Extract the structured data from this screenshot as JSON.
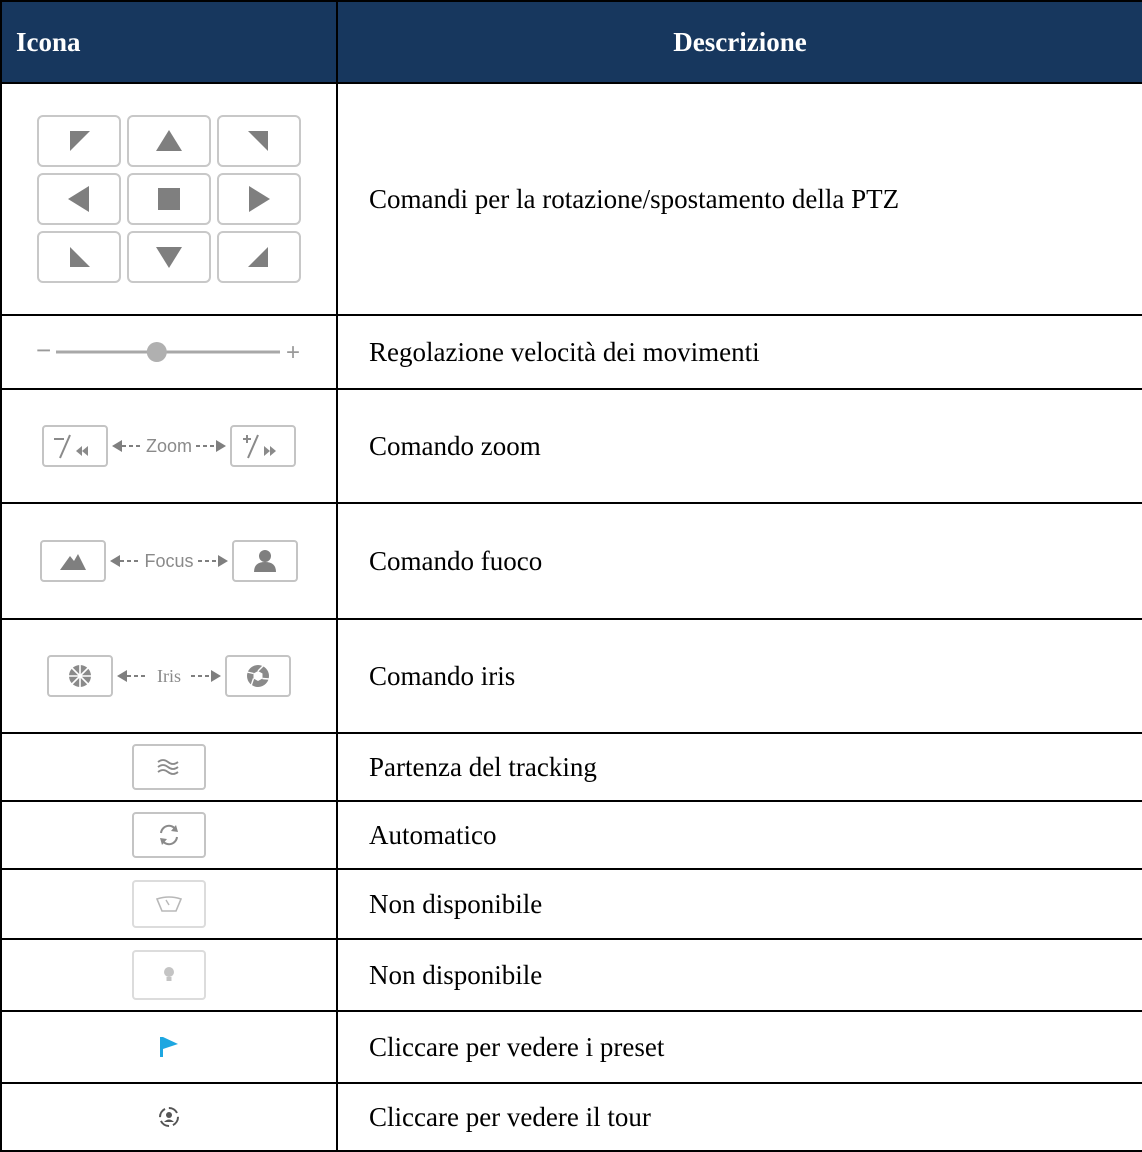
{
  "header": {
    "icon_col": "Icona",
    "desc_col": "Descrizione"
  },
  "rows": [
    {
      "icon": "ptz-direction-pad",
      "description": "Comandi per la rotazione/spostamento della PTZ"
    },
    {
      "icon": "speed-slider",
      "slider_min_symbol": "−",
      "slider_max_symbol": "+",
      "slider_level": 0.45,
      "description": "Regolazione velocità dei movimenti"
    },
    {
      "icon": "zoom-controls",
      "control_label": "Zoom",
      "minus_symbol": "−",
      "plus_symbol": "+",
      "description": "Comando zoom"
    },
    {
      "icon": "focus-controls",
      "control_label": "Focus",
      "description": "Comando fuoco"
    },
    {
      "icon": "iris-controls",
      "control_label": "Iris",
      "description": "Comando iris"
    },
    {
      "icon": "tracking-icon",
      "description": "Partenza del tracking"
    },
    {
      "icon": "auto-rotate-icon",
      "description": "Automatico"
    },
    {
      "icon": "wiper-icon",
      "description": "Non disponibile"
    },
    {
      "icon": "light-icon",
      "description": "Non disponibile"
    },
    {
      "icon": "preset-flag-icon",
      "description": "Cliccare per vedere i preset"
    },
    {
      "icon": "tour-icon",
      "description": "Cliccare per vedere il tour"
    }
  ],
  "colors": {
    "header_bg": "#17375e",
    "header_text": "#ffffff",
    "icon_gray": "#7f7f7f",
    "button_border": "#c4c4c4",
    "flag_blue": "#1ea7e1"
  }
}
